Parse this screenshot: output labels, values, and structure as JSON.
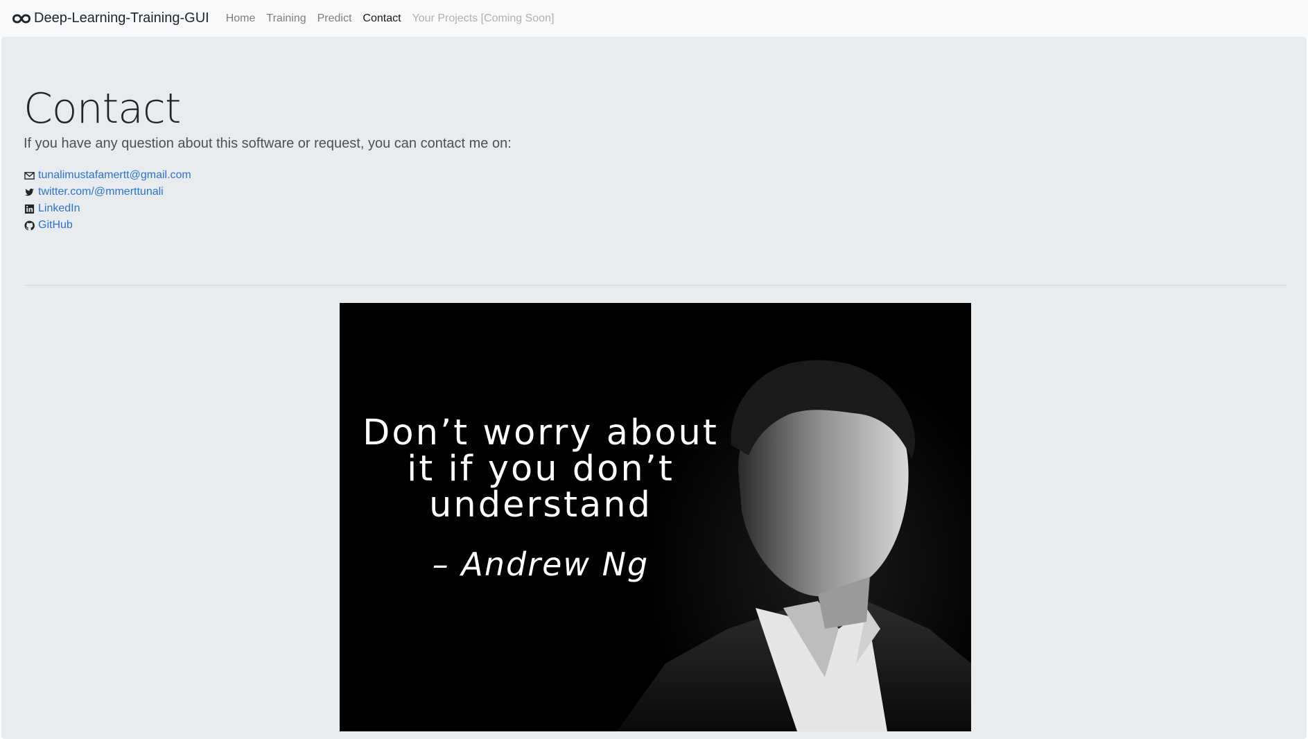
{
  "navbar": {
    "brand_label": "Deep-Learning-Training-GUI",
    "brand_icon": "infinity-icon",
    "links": [
      {
        "label": "Home",
        "state": "normal"
      },
      {
        "label": "Training",
        "state": "normal"
      },
      {
        "label": "Predict",
        "state": "normal"
      },
      {
        "label": "Contact",
        "state": "active"
      },
      {
        "label": "Your Projects [Coming Soon]",
        "state": "disabled"
      }
    ]
  },
  "main": {
    "title": "Contact",
    "lead": "If you have any question about this software or request, you can contact me on:",
    "contacts": [
      {
        "icon": "envelope-icon",
        "label": "tunalimustafamertt@gmail.com"
      },
      {
        "icon": "twitter-icon",
        "label": "twitter.com/@mmerttunali"
      },
      {
        "icon": "linkedin-icon",
        "label": "LinkedIn"
      },
      {
        "icon": "github-icon",
        "label": "GitHub"
      }
    ],
    "image": {
      "quote_lines": [
        "Don’t worry about",
        "it if you don’t",
        "understand"
      ],
      "author": "– Andrew Ng"
    }
  },
  "colors": {
    "navbar_bg": "#f8f9fa",
    "jumbotron_bg": "#e9ecef",
    "link": "#2b72c9"
  }
}
